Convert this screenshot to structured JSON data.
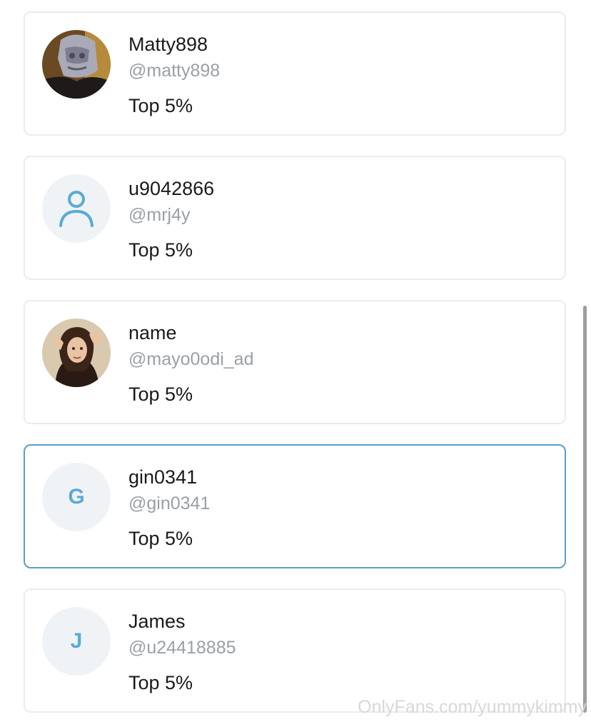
{
  "users": [
    {
      "display_name": "Matty898",
      "handle": "@matty898",
      "rank": "Top 5%",
      "avatar_type": "photo",
      "avatar_icon": "helmet-photo-icon"
    },
    {
      "display_name": "u9042866",
      "handle": "@mrj4y",
      "rank": "Top 5%",
      "avatar_type": "placeholder",
      "avatar_icon": "user-icon"
    },
    {
      "display_name": "name",
      "handle": "@mayo0odi_ad",
      "rank": "Top 5%",
      "avatar_type": "photo",
      "avatar_icon": "portrait-photo-icon"
    },
    {
      "display_name": "gin0341",
      "handle": "@gin0341",
      "rank": "Top 5%",
      "avatar_type": "initial",
      "avatar_initial": "G",
      "selected": true
    },
    {
      "display_name": "James",
      "handle": "@u24418885",
      "rank": "Top 5%",
      "avatar_type": "initial",
      "avatar_initial": "J"
    }
  ],
  "watermark": "OnlyFans.com/yummykimmy",
  "colors": {
    "accent": "#5aaad8",
    "selected_border": "#5a9ec9",
    "card_border": "#ececec",
    "handle_text": "#9aa0a6",
    "avatar_bg": "#f0f3f6"
  }
}
